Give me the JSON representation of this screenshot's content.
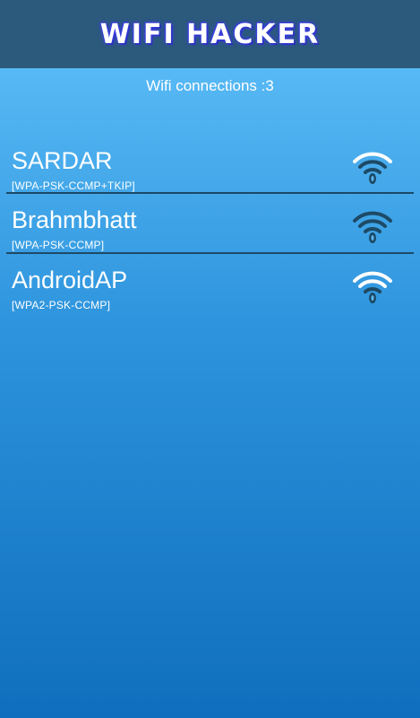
{
  "app": {
    "title": "WIFI HACKER"
  },
  "status": {
    "connections_label": "Wifi connections :3"
  },
  "networks": [
    {
      "ssid": "SARDAR",
      "security": "[WPA-PSK-CCMP+TKIP]",
      "signal_icon": "wifi-signal-strong-icon"
    },
    {
      "ssid": "Brahmbhatt",
      "security": "[WPA-PSK-CCMP]",
      "signal_icon": "wifi-signal-strong-icon"
    },
    {
      "ssid": "AndroidAP",
      "security": "[WPA2-PSK-CCMP]",
      "signal_icon": "wifi-signal-weak-icon"
    }
  ],
  "colors": {
    "header": "#2c5a7c",
    "background_top": "#62c3fb",
    "background_bottom": "#0f6fbe",
    "divider": "#1d4a66",
    "title_glow": "#3a3fe0"
  }
}
